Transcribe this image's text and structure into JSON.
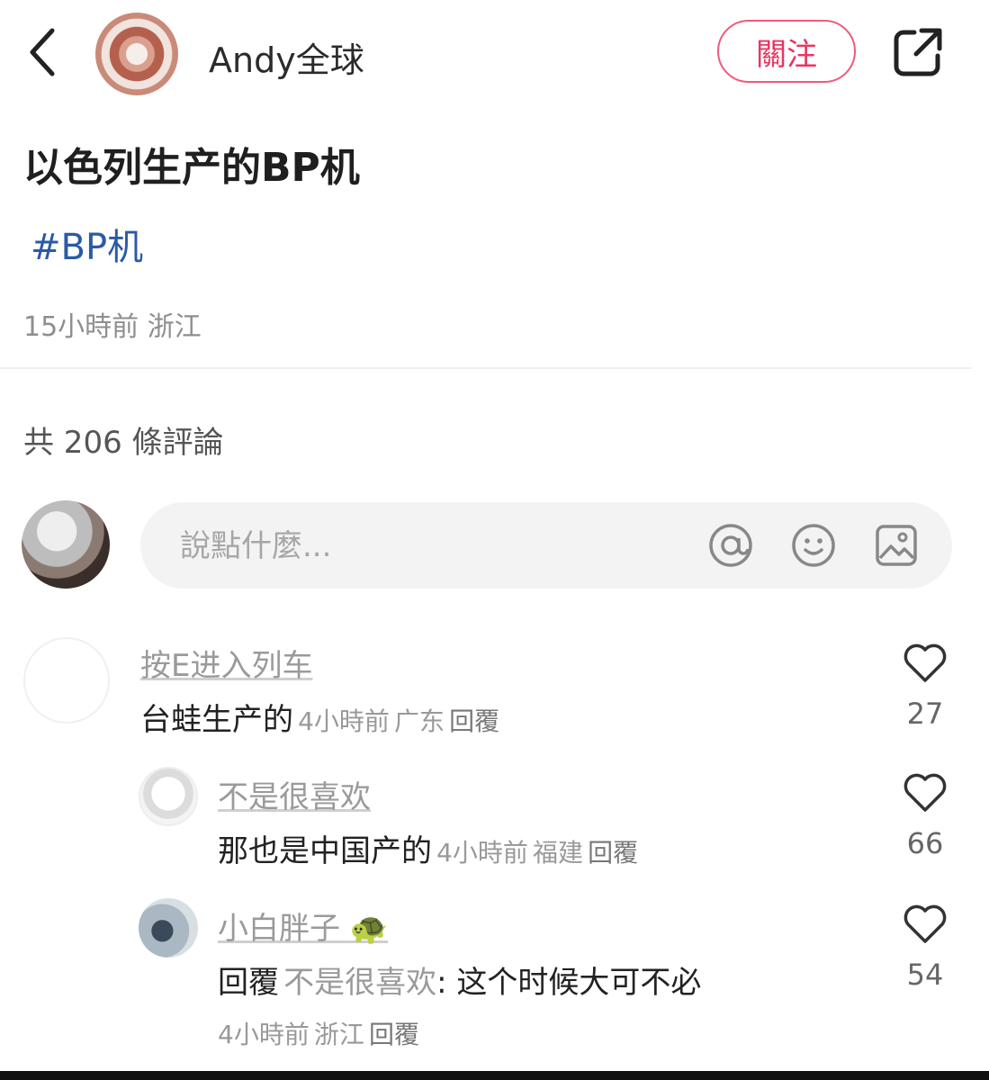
{
  "header": {
    "author_name": "Andy全球",
    "follow_label": "關注"
  },
  "post": {
    "title": "以色列生产的BP机",
    "tag": "#BP机",
    "time": "15小時前",
    "location": "浙江"
  },
  "comments_header": {
    "count_text": "共 206 條評論"
  },
  "composer": {
    "placeholder": "說點什麼...",
    "icons": [
      "at-icon",
      "emoji-icon",
      "image-icon"
    ]
  },
  "comments": [
    {
      "user": "按E进入列车",
      "text": "台蛙生产的",
      "time": "4小時前",
      "location": "广东",
      "reply_label": "回覆",
      "likes": "27"
    },
    {
      "user": "不是很喜欢",
      "text": "那也是中国产的",
      "time": "4小時前",
      "location": "福建",
      "reply_label": "回覆",
      "likes": "66"
    },
    {
      "user": "小白胖子",
      "user_badge": "🐢",
      "reply_prefix": "回覆",
      "reply_to": "不是很喜欢",
      "text": ": 这个时候大可不必",
      "time": "4小時前",
      "location": "浙江",
      "reply_label": "回覆",
      "likes": "54"
    }
  ],
  "colors": {
    "accent": "#e8355f",
    "tag": "#2b5aa6",
    "muted": "#999999"
  }
}
